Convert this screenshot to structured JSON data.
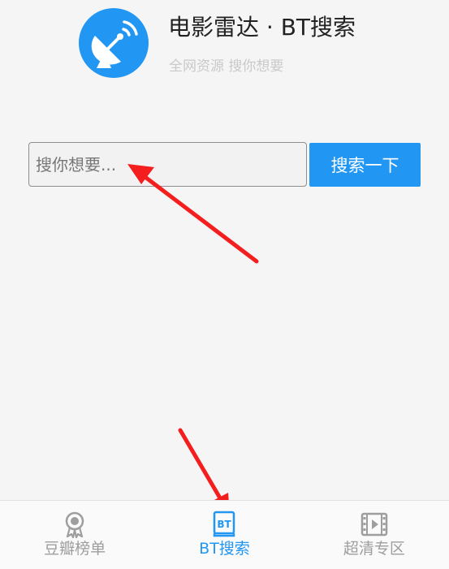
{
  "header": {
    "title": "电影雷达 · BT搜索",
    "subtitle": "全网资源 搜你想要",
    "logo_icon": "satellite-dish-icon",
    "logo_color": "#2196f3"
  },
  "search": {
    "placeholder": "搜你想要...",
    "value": "",
    "button_label": "搜索一下"
  },
  "bottom_nav": {
    "items": [
      {
        "label": "豆瓣榜单",
        "icon": "medal-icon",
        "active": false
      },
      {
        "label": "BT搜索",
        "icon": "bt-book-icon",
        "active": true
      },
      {
        "label": "超清专区",
        "icon": "film-icon",
        "active": false
      }
    ]
  },
  "colors": {
    "accent": "#2196f3",
    "annotation_arrow": "#f41e1e",
    "inactive_nav": "#9e9e9e",
    "background": "#f5f5f5"
  }
}
